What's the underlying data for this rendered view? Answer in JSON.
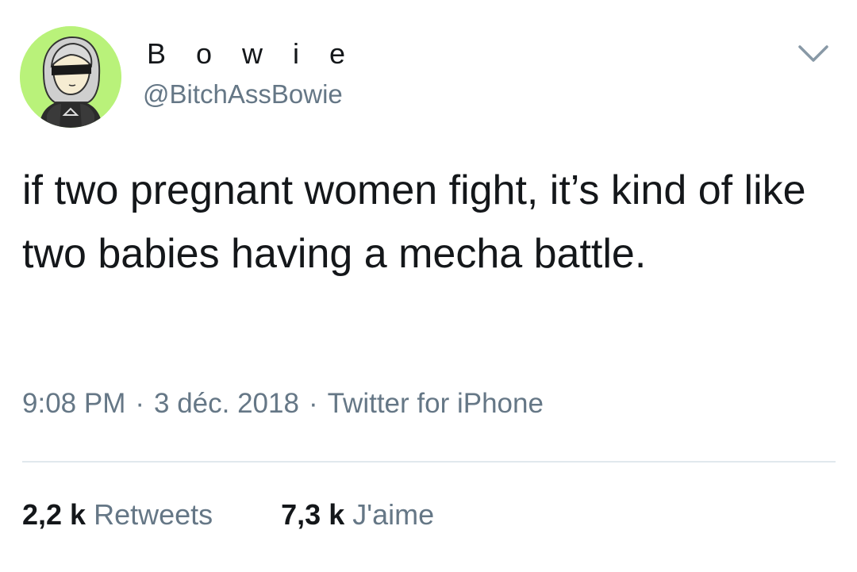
{
  "author": {
    "display_name": "B o w i e",
    "handle": "@BitchAssBowie",
    "avatar_icon": "anime-character-avatar",
    "avatar_bg": "#b9f27a"
  },
  "menu_icon": "chevron-down-icon",
  "tweet": {
    "text": "if two pregnant women fight, it’s kind of like two babies having a mecha battle."
  },
  "meta": {
    "time": "9:08 PM",
    "date": "3 déc. 2018",
    "source": "Twitter for iPhone",
    "separator": "·"
  },
  "stats": {
    "retweets_count": "2,2 k",
    "retweets_label": "Retweets",
    "likes_count": "7,3 k",
    "likes_label": "J'aime"
  },
  "colors": {
    "text": "#14171a",
    "secondary": "#657786",
    "divider": "#e1e8ed"
  }
}
